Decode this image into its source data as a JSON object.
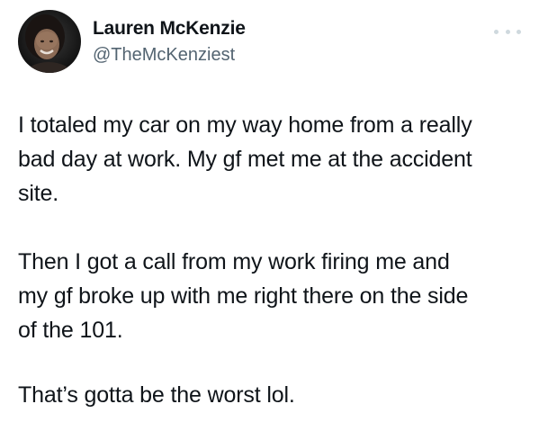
{
  "author": {
    "name": "Lauren McKenzie",
    "handle": "@TheMcKenziest",
    "avatar_icon": "profile-photo"
  },
  "more_icon": "more-options-icon",
  "tweet": {
    "lines": [
      "I totaled my car on my way home from a really",
      "bad day at work. My gf met me at the accident",
      "site.",
      "Then I got a call from my work firing me and",
      "my gf broke up with me right there on the side",
      "of the 101.",
      "That’s gotta be the worst lol."
    ]
  },
  "colors": {
    "text": "#0f1419",
    "secondary": "#536471",
    "background": "#ffffff"
  }
}
